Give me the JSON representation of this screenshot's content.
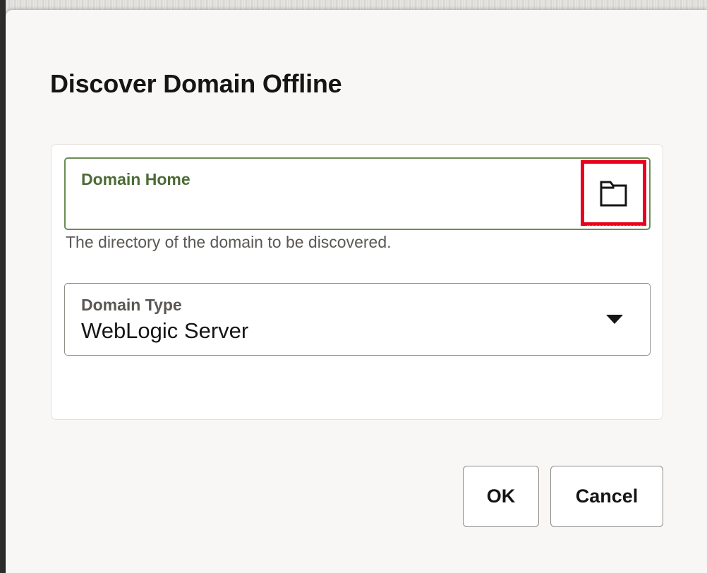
{
  "dialog": {
    "title": "Discover Domain Offline"
  },
  "domain_home": {
    "label": "Domain Home",
    "value": "",
    "help": "The directory of the domain to be discovered.",
    "browse_icon": "folder-icon"
  },
  "domain_type": {
    "label": "Domain Type",
    "value": "WebLogic Server",
    "arrow_icon": "caret-down-icon"
  },
  "buttons": {
    "ok": "OK",
    "cancel": "Cancel"
  },
  "colors": {
    "dialog_bg": "#f9f7f5",
    "focus_border": "#6c8c55",
    "focus_label": "#4d6b37",
    "highlight": "#e8001c"
  }
}
